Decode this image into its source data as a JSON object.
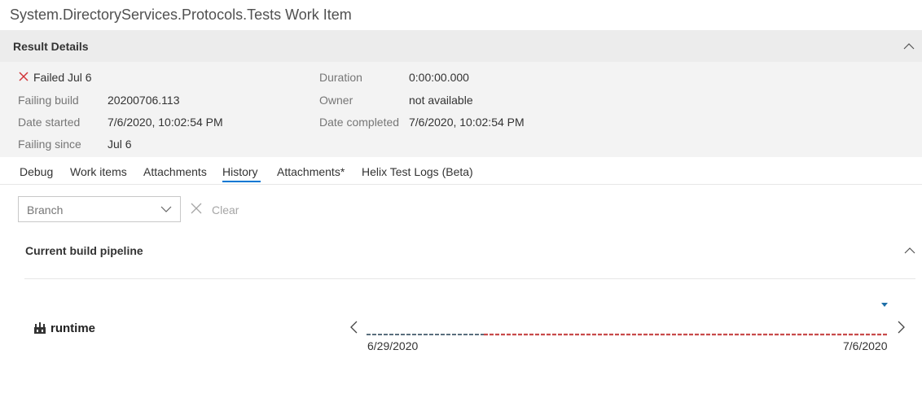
{
  "window": {
    "title": "System.DirectoryServices.Protocols.Tests Work Item"
  },
  "result_details": {
    "header": "Result Details",
    "status": "Failed Jul 6",
    "fields_left": [
      {
        "label": "Failing build",
        "value": "20200706.113"
      },
      {
        "label": "Date started",
        "value": "7/6/2020, 10:02:54 PM"
      },
      {
        "label": "Failing since",
        "value": "Jul 6"
      }
    ],
    "fields_right": [
      {
        "label": "Duration",
        "value": "0:00:00.000"
      },
      {
        "label": "Owner",
        "value": "not available"
      },
      {
        "label": "Date completed",
        "value": "7/6/2020, 10:02:54 PM"
      }
    ]
  },
  "tabs": [
    {
      "label": "Debug"
    },
    {
      "label": "Work items"
    },
    {
      "label": "Attachments"
    },
    {
      "label": "History",
      "active": true
    },
    {
      "label": "Attachments*"
    },
    {
      "label": "Helix Test Logs (Beta)"
    }
  ],
  "filter": {
    "branch_placeholder": "Branch",
    "clear_label": "Clear"
  },
  "pipeline": {
    "title": "Current build pipeline",
    "repo": "runtime",
    "date_start": "6/29/2020",
    "date_end": "7/6/2020",
    "colors": {
      "passed": "#5a6f7d",
      "failed": "#c84b4b",
      "marker": "#1e6fa8"
    },
    "failure_start_fraction": 0.225
  }
}
